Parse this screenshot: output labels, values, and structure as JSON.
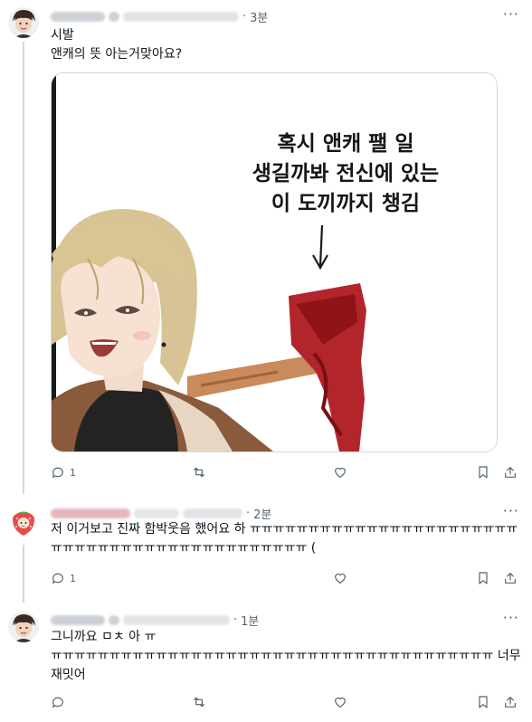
{
  "posts": [
    {
      "time": "3분",
      "text_lines": [
        "시발",
        "앤캐의 뜻 아는거맞아요?"
      ],
      "media_caption": [
        "혹시 앤캐 팰 일",
        "생길까봐 전신에 있는",
        "이 도끼까지 챙김"
      ],
      "reply_count": "1"
    },
    {
      "time": "2분",
      "text_lines": [
        "저 이거보고 진짜 함박웃음 했어요 하 ㅠㅠㅠㅠㅠㅠㅠㅠㅠㅠㅠㅠㅠㅠㅠㅠㅠㅠㅠㅠㅠㅠㅠㅠㅠㅠㅠㅠㅠㅠㅠㅠㅠㅠㅠㅠㅠㅠㅠㅠㅠㅠㅠㅠㅠ ("
      ],
      "reply_count": "1"
    },
    {
      "time": "1분",
      "text_lines": [
        "그니까요 ㅁㅊ 아 ㅠ",
        "ㅠㅠㅠㅠㅠㅠㅠㅠㅠㅠㅠㅠㅠㅠㅠㅠㅠㅠㅠㅠㅠㅠㅠㅠㅠㅠㅠㅠㅠㅠㅠㅠㅠㅠㅠㅠㅠㅠ 너무재밋어"
      ],
      "reply_count": ""
    }
  ],
  "more_label": "···",
  "dot": "·",
  "icons": [
    "reply-icon",
    "retweet-icon",
    "like-icon",
    "bookmark-icon",
    "share-icon"
  ]
}
